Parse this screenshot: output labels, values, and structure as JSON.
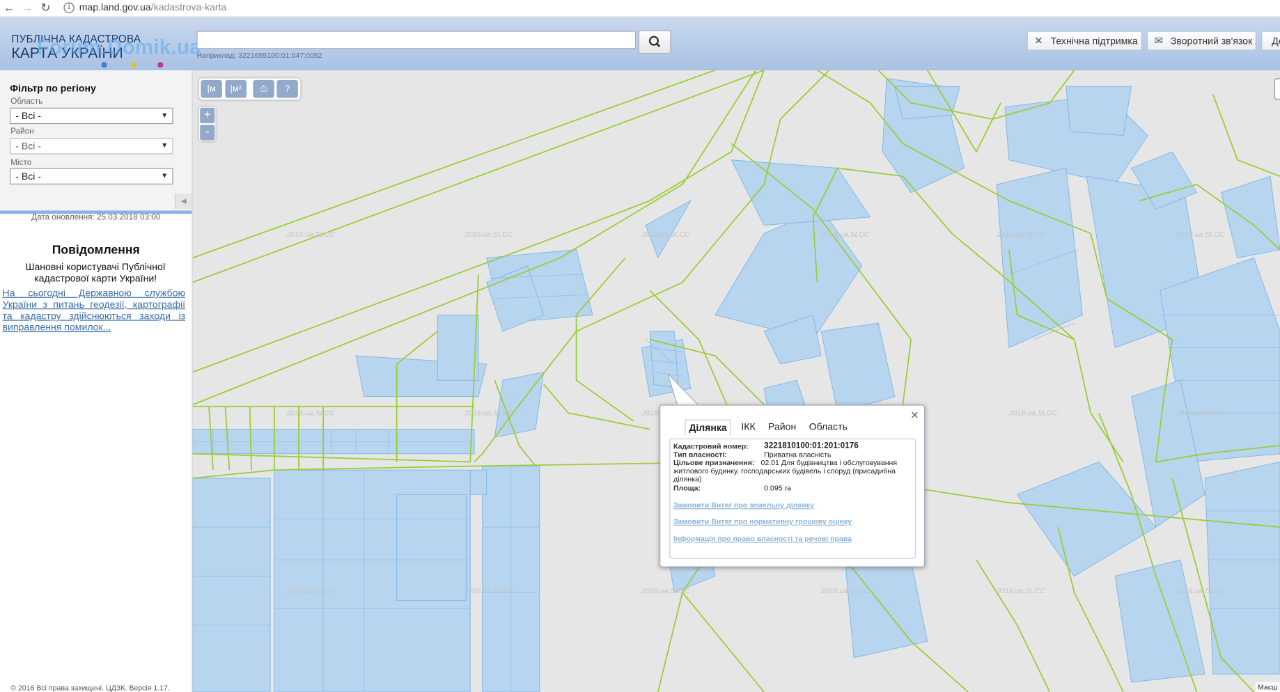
{
  "browser": {
    "domain": "map.land.gov.ua",
    "path": "/kadastrova-karta"
  },
  "header": {
    "logo_line1": "ПУБЛІЧНА КАДАСТРОВА",
    "logo_line2": "КАРТА УКРАЇНИ",
    "watermark": "Forum.Domik.ua",
    "search_value": "",
    "search_hint": "Наприклад: 3221655100:01:047:0052",
    "support_label": "Технічна підтримка",
    "feedback_label": "Зворотний зв'язок",
    "access_label": "До"
  },
  "sidebar": {
    "filter_title": "Фільтр по регіону",
    "oblast_label": "Область",
    "oblast_value": "- Всі -",
    "rayon_label": "Район",
    "rayon_value": "- Всі -",
    "city_label": "Місто",
    "city_value": "- Всі -",
    "updated": "Дата оновлення: 25.03.2018 03:00",
    "message_title": "Повідомлення",
    "message_greeting": "Шановні користувачі Публічної кадастрової карти України!",
    "message_link": "На сьогодні Державною службою України з питань геодезії, картографії та кадастру здійснюються заходи із виправлення помилок...",
    "copyright": "© 2016 Всі права захищені. ЦДЗК. Версія 1.17."
  },
  "map": {
    "tools": [
      "|м",
      "|м²",
      "print",
      "?"
    ],
    "zoom_in": "+",
    "zoom_out": "-",
    "watermark_text": "2018.ua.SLCC",
    "scale_label": "Масш",
    "colors": {
      "boundary": "#9acd32",
      "parcel": "#b7d5ef",
      "background": "#e6e6e6"
    }
  },
  "popup": {
    "tabs": [
      "Ділянка",
      "ІКК",
      "Район",
      "Область"
    ],
    "active_tab": "Ділянка",
    "cadastral_label": "Кадастровий номер:",
    "cadastral_value": "3221810100:01:201:0176",
    "ownership_label": "Тип власності:",
    "ownership_value": "Приватна власність",
    "purpose_label": "Цільове призначення:",
    "purpose_value": "02.01 Для будівництва і обслуговування житлового будинку, господарських будівель і споруд (присадибна ділянка)",
    "area_label": "Площа:",
    "area_value": "0.095 га",
    "link1": "Замовити Витяг про земельну ділянку",
    "link2": "Замовити Витяг про нормативну грошову оцінку",
    "link3": "Інформація про право власності та речові права"
  }
}
